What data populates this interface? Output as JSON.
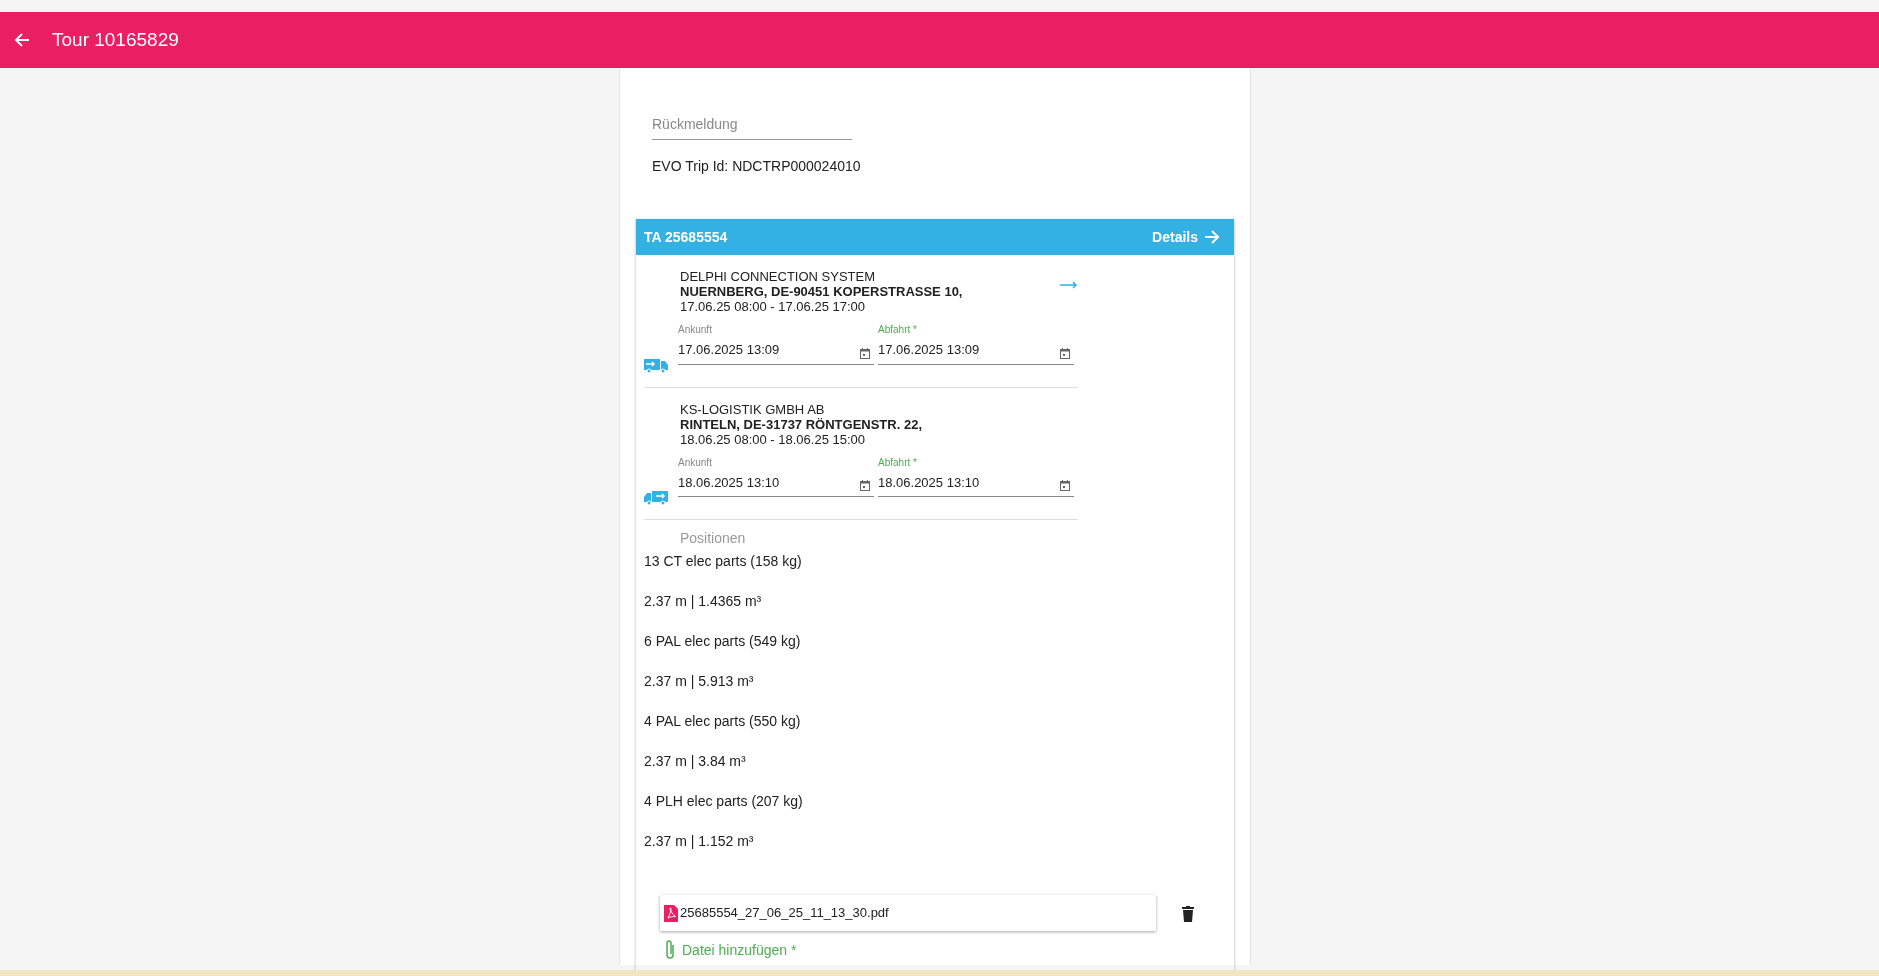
{
  "app_bar": {
    "title": "Tour 10165829"
  },
  "feedback": {
    "placeholder": "Rückmeldung"
  },
  "trip_id": "EVO Trip Id: NDCTRP000024010",
  "order": {
    "title": "TA 25685554",
    "details_label": "Details",
    "stops": [
      {
        "kind": "pickup",
        "name": "DELPHI CONNECTION SYSTEM",
        "address": "NUERNBERG, DE-90451 KOPERSTRASSE 10,",
        "window": "17.06.25 08:00 - 17.06.25 17:00",
        "arrival_label": "Ankunft",
        "arrival": "17.06.2025 13:09",
        "departure_label": "Abfahrt *",
        "departure": "17.06.2025 13:09"
      },
      {
        "kind": "delivery",
        "name": "KS-LOGISTIK GMBH AB",
        "address": "RINTELN, DE-31737 RÖNTGENSTR. 22,",
        "window": "18.06.25 08:00 - 18.06.25 15:00",
        "arrival_label": "Ankunft",
        "arrival": "18.06.2025 13:10",
        "departure_label": "Abfahrt *",
        "departure": "18.06.2025 13:10"
      }
    ],
    "positions_label": "Positionen",
    "positions": [
      "13 CT elec parts (158 kg)",
      "2.37 m | 1.4365 m³",
      "6 PAL elec parts (549 kg)",
      "2.37 m | 5.913 m³",
      "4 PAL elec parts (550 kg)",
      "2.37 m | 3.84 m³",
      "4 PLH elec parts (207 kg)",
      "2.37 m | 1.152 m³"
    ],
    "attachments": [
      {
        "file": "25685554_27_06_25_11_13_30.pdf"
      }
    ],
    "add_file_label": "Datei hinzufügen *"
  }
}
